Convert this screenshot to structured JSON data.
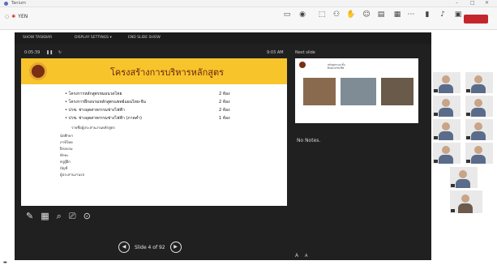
{
  "window": {
    "title": "Tanium",
    "address": "YEN",
    "controls": [
      "–",
      "□",
      "✕"
    ]
  },
  "toolbar": {
    "items": [
      {
        "icon": "layout-icon",
        "glyph": "▭",
        "label": ""
      },
      {
        "icon": "record-icon",
        "glyph": "◉",
        "label": ""
      },
      {
        "icon": "share-icon",
        "glyph": "⬚",
        "label": ""
      },
      {
        "icon": "people-icon",
        "glyph": "⚇",
        "label": ""
      },
      {
        "icon": "hand-icon",
        "glyph": "✋",
        "label": ""
      },
      {
        "icon": "reactions-icon",
        "glyph": "☺",
        "label": ""
      },
      {
        "icon": "view-icon",
        "glyph": "▤",
        "label": ""
      },
      {
        "icon": "rooms-icon",
        "glyph": "▦",
        "label": ""
      },
      {
        "icon": "more-icon",
        "glyph": "⋯",
        "label": ""
      },
      {
        "icon": "camera-icon",
        "glyph": "▮",
        "label": ""
      },
      {
        "icon": "mic-icon",
        "glyph": "♪",
        "label": ""
      },
      {
        "icon": "share-screen-icon",
        "glyph": "▣",
        "label": ""
      }
    ],
    "leave_label": ""
  },
  "presenter": {
    "taskbar": [
      "SHOW TASKBAR",
      "DISPLAY SETTINGS ▾",
      "END SLIDE SHOW"
    ],
    "timer": "0:05:39",
    "clock": "9:03 AM",
    "next_slide_label": "Next slide",
    "notes": "No Notes.",
    "slide_counter": "Slide 4 of 92",
    "font_buttons": [
      "A",
      "A"
    ]
  },
  "slide": {
    "title": "โครงสร้างการบริหารหลักสูตร",
    "bullets": [
      {
        "text": "โครงการหลักสูตรหมอนวดไทย",
        "rooms": "2 ห้อง"
      },
      {
        "text": "โครงการฝึกอบรมหลักสูตรแพทย์แผนไทย-จีน",
        "rooms": "2 ห้อง"
      },
      {
        "text": "ปวช. ช่างอุตสาหกรรมช่างไฟฟ้า",
        "rooms": "2 ห้อง"
      },
      {
        "text": "ปวช. ช่างอุตสาหกรรมช่างไฟฟ้า (ภาคค่ำ)",
        "rooms": "1 ห้อง"
      }
    ],
    "subtitle": "รายชื่อผู้ประสานงานหลักสูตร",
    "sub_items": [
      "นักศึกษา",
      "ภาษีไทย",
      "ฝึกอบรม",
      "ทักษะ",
      "ครูผู้ฝึก",
      "บัญชี",
      "ผู้ประสานงานรถ"
    ]
  },
  "next_slide": {
    "title": "หลักสูตรระยะสั้น\nฝึกอบรมวิชาชีพ"
  },
  "colors": {
    "accent": "#f7c52b",
    "leave": "#c4262e",
    "stage": "#202020"
  }
}
